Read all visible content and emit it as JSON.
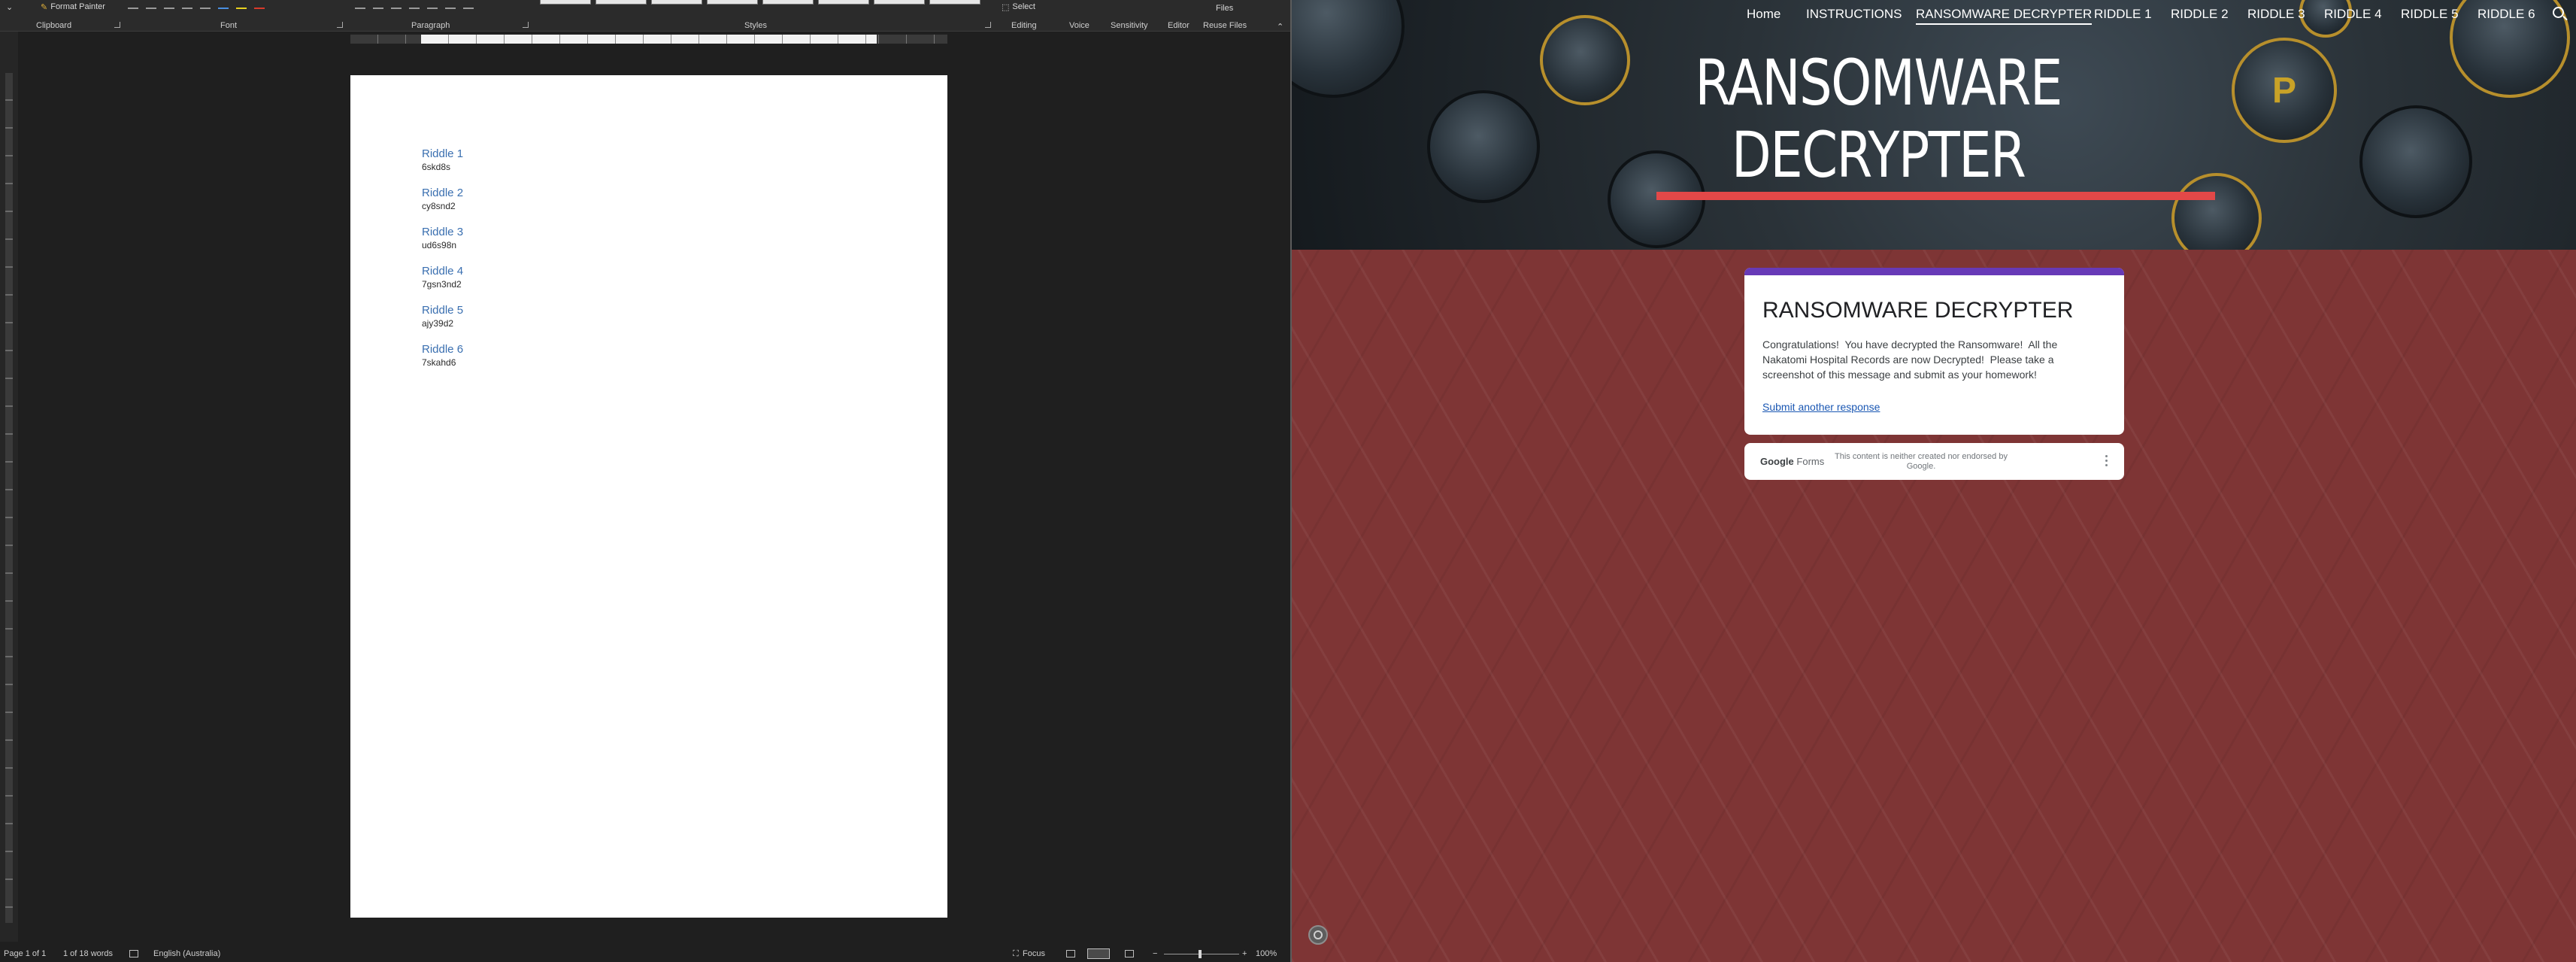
{
  "word": {
    "ribbon": {
      "format_painter": "Format Painter",
      "select": "Select",
      "files_top": "Files",
      "groups": {
        "clipboard": "Clipboard",
        "font": "Font",
        "paragraph": "Paragraph",
        "styles": "Styles",
        "editing": "Editing",
        "voice": "Voice",
        "sensitivity": "Sensitivity",
        "editor": "Editor",
        "reuse_files": "Reuse Files"
      }
    },
    "document": {
      "riddles": [
        {
          "heading": "Riddle 1",
          "code": "6skd8s"
        },
        {
          "heading": "Riddle 2",
          "code": "cy8snd2"
        },
        {
          "heading": "Riddle 3",
          "code": "ud6s98n"
        },
        {
          "heading": "Riddle 4",
          "code": "7gsn3nd2"
        },
        {
          "heading": "Riddle 5",
          "code": "ajy39d2"
        },
        {
          "heading": "Riddle 6",
          "code": "7skahd6"
        }
      ]
    },
    "status": {
      "page": "Page 1 of 1",
      "words": "1 of 18 words",
      "language": "English (Australia)",
      "focus": "Focus",
      "zoom": "100%"
    }
  },
  "site": {
    "nav": [
      {
        "label": "Home"
      },
      {
        "label": "INSTRUCTIONS"
      },
      {
        "label": "RANSOMWARE DECRYPTER"
      },
      {
        "label": "RIDDLE 1"
      },
      {
        "label": "RIDDLE 2"
      },
      {
        "label": "RIDDLE 3"
      },
      {
        "label": "RIDDLE 4"
      },
      {
        "label": "RIDDLE 5"
      },
      {
        "label": "RIDDLE 6"
      }
    ],
    "hero_title": "RANSOMWARE DECRYPTER",
    "form": {
      "title": "RANSOMWARE DECRYPTER",
      "message": "Congratulations!  You have decrypted the Ransomware!  All the Nakatomi Hospital Records are now Decrypted!  Please take a screenshot of this message and submit as your homework!",
      "link": "Submit another response"
    },
    "footer": {
      "logo_google": "Google",
      "logo_forms": "Forms",
      "disclaimer": "This content is neither created nor endorsed by Google."
    }
  },
  "colors": {
    "form_accent": "#673ab7",
    "hero_underline": "#e34848",
    "site_background": "#7e3535",
    "riddle_heading": "#3a6fb0",
    "link": "#1a57b3"
  },
  "icons": [
    "format-painter-icon",
    "select-icon",
    "focus-icon",
    "search-icon",
    "info-icon",
    "more-vert-icon"
  ]
}
